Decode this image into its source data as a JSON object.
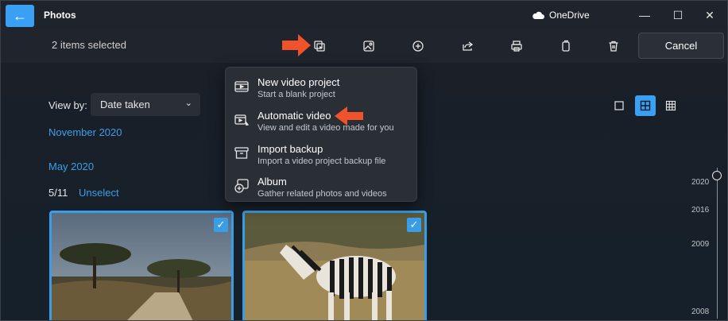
{
  "titlebar": {
    "back_glyph": "←",
    "app_title": "Photos",
    "onedrive_label": "OneDrive",
    "controls": [
      "—",
      "☐",
      "✕"
    ]
  },
  "command_bar": {
    "selection_text": "2 items selected",
    "icons": [
      "create-video-icon",
      "edit-image-icon",
      "add-icon",
      "share-icon",
      "print-icon",
      "copy-icon",
      "delete-icon"
    ],
    "cancel_label": "Cancel"
  },
  "view": {
    "view_by_label": "View by:",
    "view_by_value": "Date taken",
    "chevron": "⌄",
    "layout_options": [
      "single-view-icon",
      "grid-view-icon",
      "dense-grid-view-icon"
    ],
    "active_layout": "grid-view-icon"
  },
  "sections": {
    "month1": "November 2020",
    "month2": "May 2020",
    "count": "5/11",
    "unselect": "Unselect"
  },
  "menu": {
    "items": [
      {
        "title": "New video project",
        "subtitle": "Start a blank project",
        "icon": "film-icon"
      },
      {
        "title": "Automatic video",
        "subtitle": "View and edit a video made for you",
        "icon": "auto-video-icon"
      },
      {
        "title": "Import backup",
        "subtitle": "Import a video project backup file",
        "icon": "archive-icon"
      },
      {
        "title": "Album",
        "subtitle": "Gather related photos and videos",
        "icon": "album-icon"
      }
    ]
  },
  "timeline": {
    "years": [
      "2020",
      "2016",
      "2009",
      "2008"
    ]
  },
  "colors": {
    "accent": "#3aa0f3",
    "arrow": "#f0522b"
  }
}
